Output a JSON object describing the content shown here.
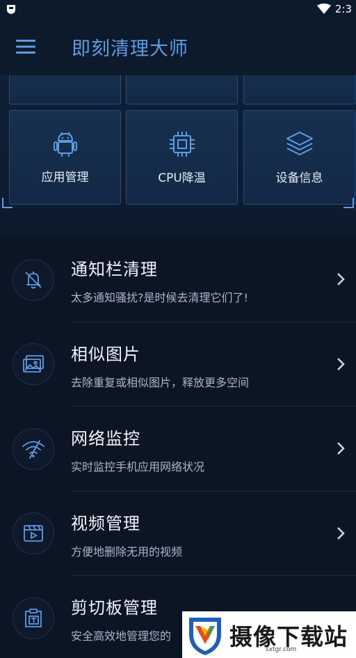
{
  "status_bar": {
    "time": "2:3"
  },
  "header": {
    "title": "即刻清理大师"
  },
  "grid": {
    "top_partial": [
      "",
      "",
      ""
    ],
    "tiles": [
      {
        "label": "应用管理",
        "icon": "android-icon"
      },
      {
        "label": "CPU降温",
        "icon": "cpu-chip-icon"
      },
      {
        "label": "设备信息",
        "icon": "layers-icon"
      }
    ]
  },
  "list": [
    {
      "title": "通知栏清理",
      "subtitle": "太多通知骚扰?是时候去清理它们了!",
      "icon": "bell-off-icon"
    },
    {
      "title": "相似图片",
      "subtitle": "去除重复或相似图片，释放更多空间",
      "icon": "images-icon"
    },
    {
      "title": "网络监控",
      "subtitle": "实时监控手机应用网络状况",
      "icon": "wifi-monitor-icon"
    },
    {
      "title": "视频管理",
      "subtitle": "方便地删除无用的视频",
      "icon": "video-icon"
    },
    {
      "title": "剪切板管理",
      "subtitle": "安全高效地管理您的",
      "icon": "clipboard-icon"
    }
  ],
  "watermark": {
    "text": "摄像下载站",
    "url": "sxtgr.com"
  },
  "colors": {
    "accent": "#5d9de6",
    "background": "#0b1524",
    "tile": "#17304f"
  }
}
